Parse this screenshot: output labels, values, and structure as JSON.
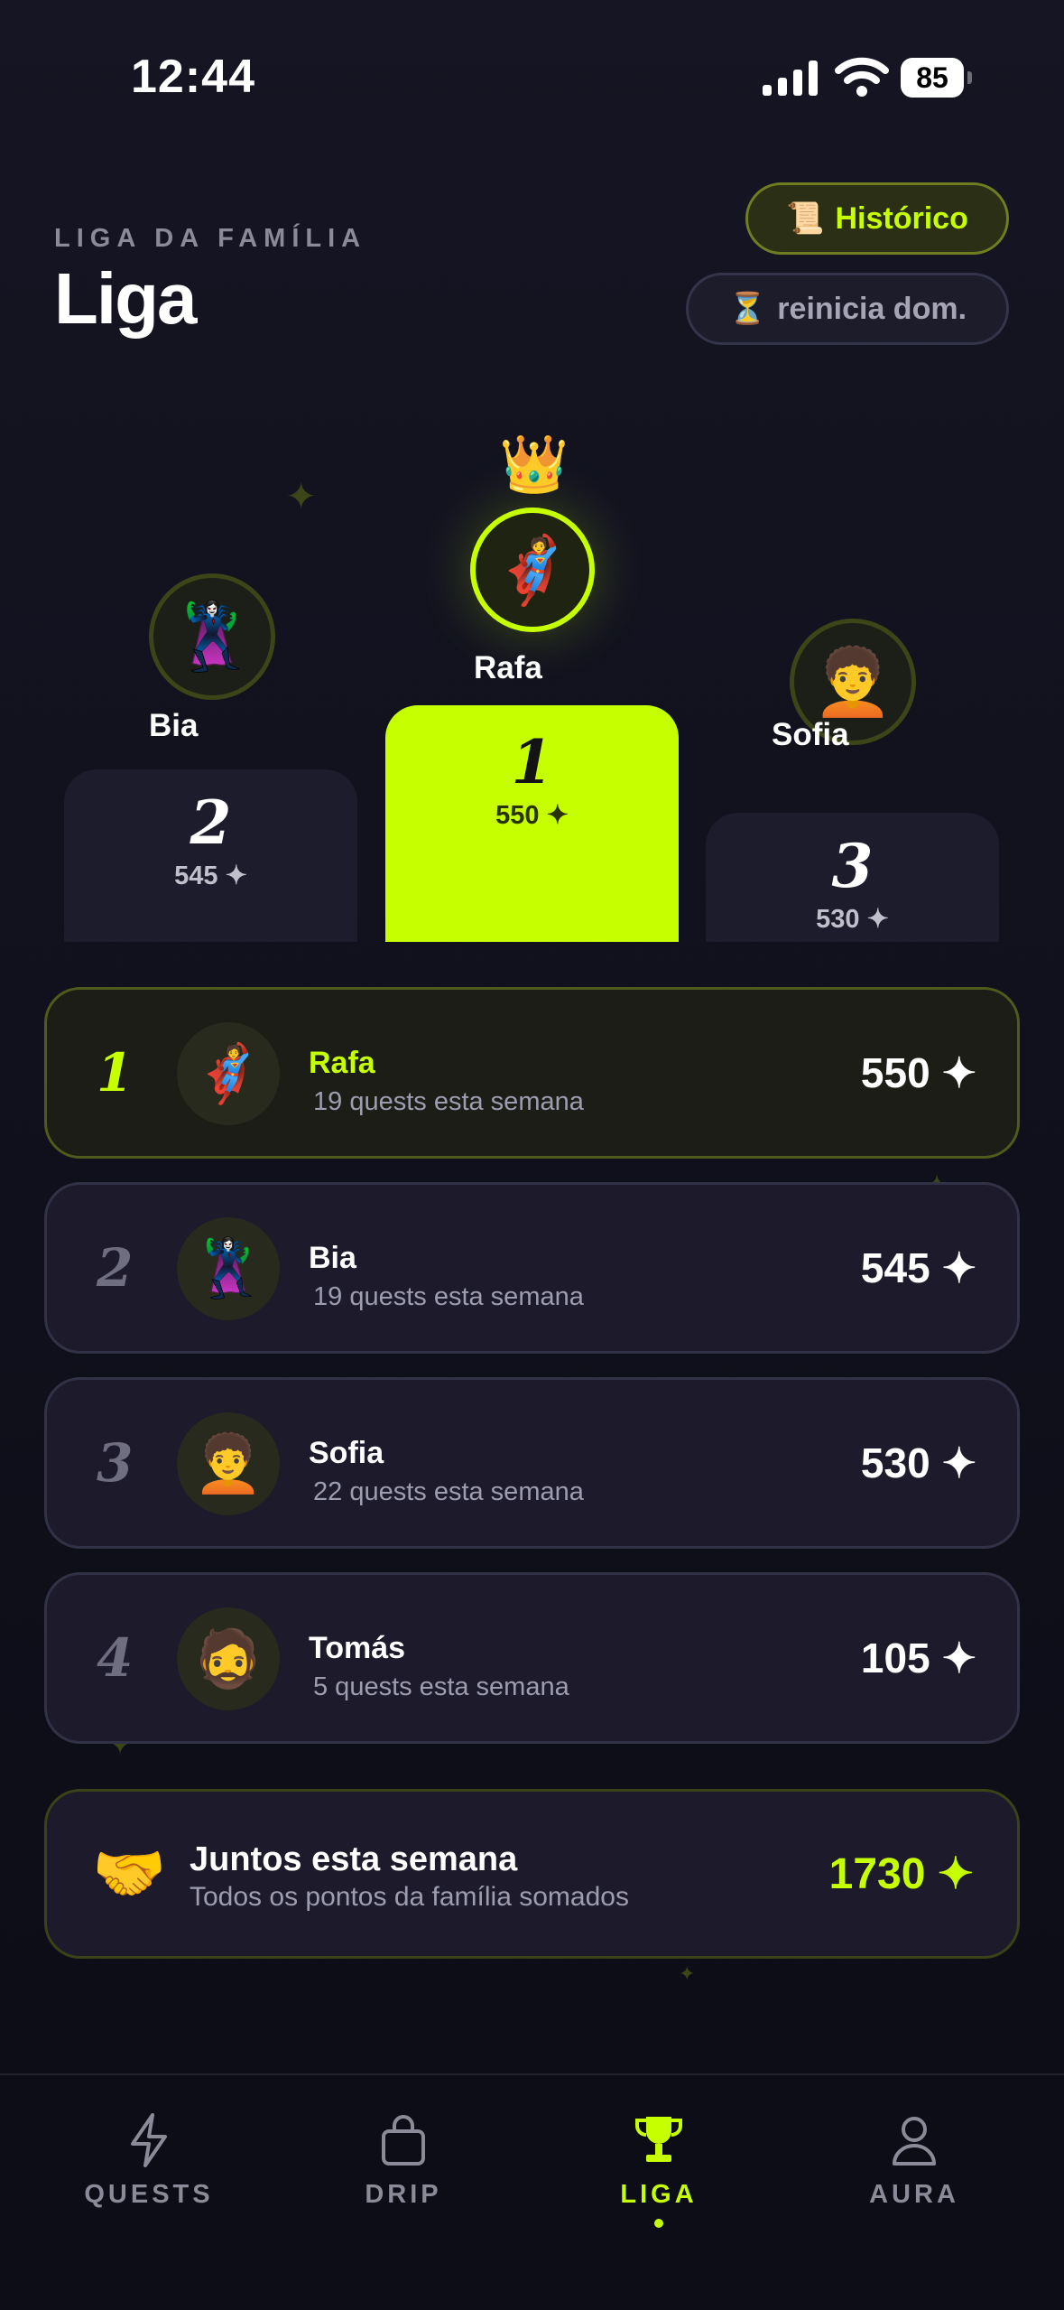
{
  "status_bar": {
    "time": "12:44",
    "battery": "85"
  },
  "header": {
    "kicker": "LIGA DA FAMÍLIA",
    "title": "Liga",
    "history_button": {
      "icon": "scroll-icon",
      "emoji": "📜",
      "label": "Histórico"
    },
    "reset_pill": {
      "icon": "hourglass-icon",
      "emoji": "⏳",
      "label": "reinicia dom."
    }
  },
  "podium": {
    "crown": "👑",
    "first": {
      "name": "Rafa",
      "avatar": "🦸",
      "rank": "1",
      "points": "550 ✦"
    },
    "second": {
      "name": "Bia",
      "avatar": "🦹‍♀️",
      "rank": "2",
      "points": "545 ✦"
    },
    "third": {
      "name": "Sofia",
      "avatar": "🧑‍🦱",
      "rank": "3",
      "points": "530 ✦"
    }
  },
  "leaderboard": [
    {
      "rank": "1",
      "avatar": "🦸",
      "name": "Rafa",
      "subtitle": "19 quests esta semana",
      "points": "550 ✦"
    },
    {
      "rank": "2",
      "avatar": "🦹‍♀️",
      "name": "Bia",
      "subtitle": "19 quests esta semana",
      "points": "545 ✦"
    },
    {
      "rank": "3",
      "avatar": "🧑‍🦱",
      "name": "Sofia",
      "subtitle": "22 quests esta semana",
      "points": "530 ✦"
    },
    {
      "rank": "4",
      "avatar": "🧔",
      "name": "Tomás",
      "subtitle": "5 quests esta semana",
      "points": "105 ✦"
    }
  ],
  "total_card": {
    "emoji": "🤝",
    "title": "Juntos esta semana",
    "subtitle": "Todos os pontos da família somados",
    "points": "1730 ✦"
  },
  "tabbar": {
    "tabs": [
      {
        "label": "QUESTS",
        "icon": "lightning-icon"
      },
      {
        "label": "DRIP",
        "icon": "shopping-bag-icon"
      },
      {
        "label": "LIGA",
        "icon": "trophy-icon",
        "active": true
      },
      {
        "label": "AURA",
        "icon": "person-icon"
      }
    ]
  },
  "colors": {
    "accent": "#c6ff00",
    "background": "#12121e",
    "card": "#1c1a2b",
    "muted_text": "#9d9db0"
  }
}
